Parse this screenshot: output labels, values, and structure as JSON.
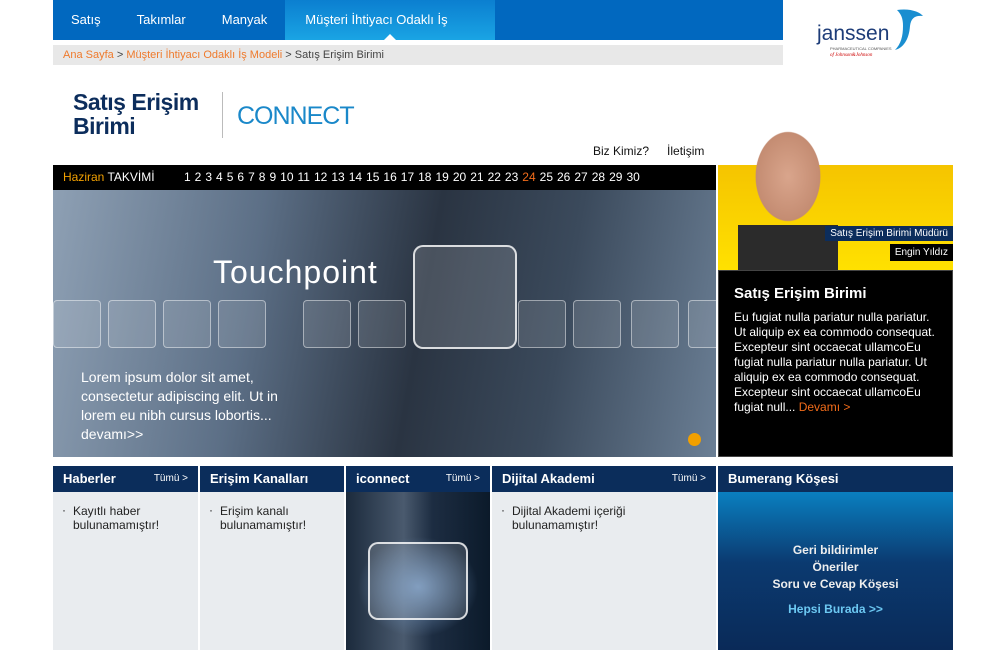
{
  "nav": {
    "items": [
      "Satış",
      "Takımlar",
      "Manyak",
      "Müşteri İhtiyacı Odaklı İş Modeli"
    ],
    "active": 3
  },
  "breadcrumb": {
    "items": [
      "Ana Sayfa",
      "Müşteri İhtiyacı Odaklı İş Modeli"
    ],
    "current": "Satış Erişim Birimi",
    "sep": ">"
  },
  "brand": {
    "logo_text": "janssen",
    "logo_sub": "PHARMACEUTICAL COMPANIES of Johnson & Johnson",
    "site_title_1": "Satış Erişim",
    "site_title_2": "Birimi",
    "connect_logo": "CONNECT"
  },
  "toplinks": [
    "Biz Kimiz?",
    "İletişim"
  ],
  "calendar": {
    "month": "Haziran",
    "label": "TAKVİMİ",
    "days": [
      "1",
      "2",
      "3",
      "4",
      "5",
      "6",
      "7",
      "8",
      "9",
      "10",
      "11",
      "12",
      "13",
      "14",
      "15",
      "16",
      "17",
      "18",
      "19",
      "20",
      "21",
      "22",
      "23",
      "24",
      "25",
      "26",
      "27",
      "28",
      "29",
      "30"
    ],
    "highlight": "24",
    "highlight_color": "#f26c1a"
  },
  "hero": {
    "title": "Touchpoint",
    "text": "Lorem ipsum dolor sit amet, consectetur adipiscing elit. Ut in lorem eu nibh cursus lobortis... devamı>>"
  },
  "profile": {
    "role": "Satış Erişim Birimi Müdürü",
    "name": "Engin Yıldız",
    "heading": "Satış Erişim Birimi",
    "text": "Eu fugiat nulla pariatur nulla pariatur. Ut aliquip ex ea commodo consequat. Excepteur sint occaecat ullamcoEu fugiat nulla pariatur nulla pariatur. Ut aliquip ex ea commodo consequat. Excepteur sint occaecat ullamcoEu fugiat null...",
    "more": "Devamı >"
  },
  "columns": [
    {
      "title": "Haberler",
      "more": "Tümü >",
      "text": "Kayıtlı haber bulunamamıştır!"
    },
    {
      "title": "Erişim Kanalları",
      "text": "Erişim kanalı bulunamamıştır!"
    },
    {
      "title": "iconnect",
      "more": "Tümü >"
    },
    {
      "title": "Dijital Akademi",
      "more": "Tümü >",
      "text": "Dijital Akademi içeriği bulunamamıştır!"
    },
    {
      "title": "Bumerang Köşesi",
      "lines": [
        "Geri bildirimler",
        "Öneriler",
        "Soru ve Cevap Köşesi"
      ],
      "link": "Hepsi Burada >>"
    }
  ]
}
